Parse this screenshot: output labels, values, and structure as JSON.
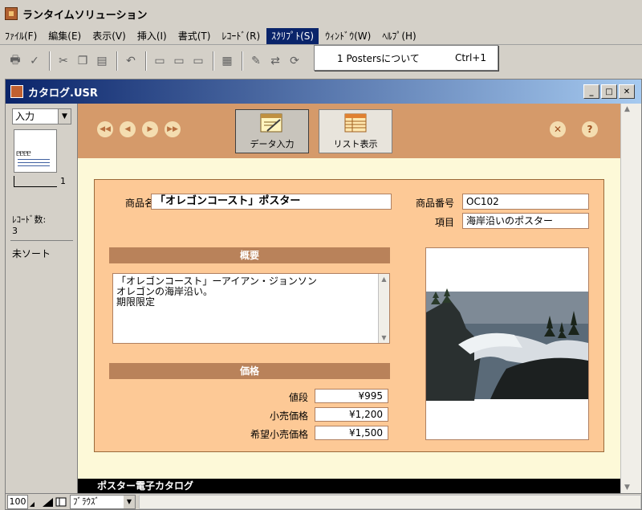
{
  "app": {
    "title": "ランタイムソリューション"
  },
  "menu": [
    {
      "label": "ﾌｧｲﾙ(F)"
    },
    {
      "label": "編集(E)"
    },
    {
      "label": "表示(V)"
    },
    {
      "label": "挿入(I)"
    },
    {
      "label": "書式(T)"
    },
    {
      "label": "ﾚｺｰﾄﾞ(R)"
    },
    {
      "label": "ｽｸﾘﾌﾟﾄ(S)",
      "active": true
    },
    {
      "label": "ｳｨﾝﾄﾞｳ(W)"
    },
    {
      "label": "ﾍﾙﾌﾟ(H)"
    }
  ],
  "dropdown": {
    "item_label": "1 Postersについて",
    "shortcut": "Ctrl+1"
  },
  "window": {
    "title": "カタログ.USR"
  },
  "status": {
    "mode": "入力",
    "page_number": "1",
    "record_label": "ﾚｺｰﾄﾞ数:",
    "record_count": "3",
    "sort": "未ソート"
  },
  "buttons": {
    "data_entry": "データ入力",
    "list_view": "リスト表示"
  },
  "form": {
    "product_name_label": "商品名",
    "product_name": "「オレゴンコースト」ポスター",
    "product_no_label": "商品番号",
    "product_no": "OC102",
    "item_label": "項目",
    "item": "海岸沿いのポスター",
    "summary_header": "概要",
    "summary_lines": [
      "「オレゴンコースト」ーアイアン・ジョンソン",
      "オレゴンの海岸沿い。",
      "期限限定"
    ],
    "price_header": "価格",
    "prices": [
      {
        "label": "値段",
        "value": "¥995"
      },
      {
        "label": "小売価格",
        "value": "¥1,200"
      },
      {
        "label": "希望小売価格",
        "value": "¥1,500"
      }
    ]
  },
  "footer": {
    "title": "ポスター電子カタログ"
  },
  "bottom": {
    "zoom": "100",
    "mode": "ﾌﾞﾗｳｽﾞ"
  },
  "colors": {
    "header_band": "#d59a6a",
    "panel": "#fdc996",
    "section_bar": "#b9825a",
    "content_bg": "#fdf9d8"
  }
}
